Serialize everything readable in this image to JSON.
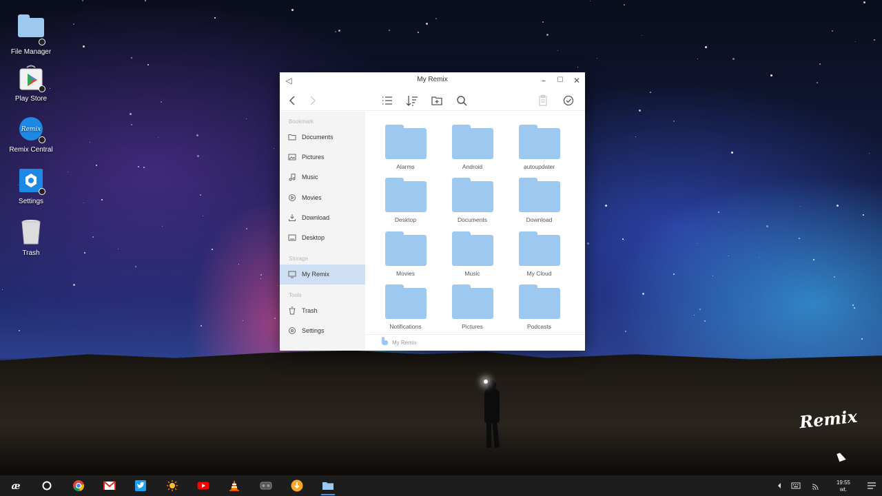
{
  "desktop": {
    "icons": [
      {
        "label": "File Manager",
        "icon": "folder-icon"
      },
      {
        "label": "Play Store",
        "icon": "play-store-icon"
      },
      {
        "label": "Remix Central",
        "icon": "remix-central-icon"
      },
      {
        "label": "Settings",
        "icon": "settings-icon"
      },
      {
        "label": "Trash",
        "icon": "trash-icon"
      }
    ],
    "watermark": "Remix"
  },
  "window": {
    "title": "My Remix",
    "sidebar": {
      "sections": {
        "bookmark": "Bookmark",
        "storage": "Storage",
        "tools": "Tools"
      },
      "bookmarks": [
        {
          "label": "Documents",
          "icon": "document-icon"
        },
        {
          "label": "Pictures",
          "icon": "picture-icon"
        },
        {
          "label": "Music",
          "icon": "music-icon"
        },
        {
          "label": "Movies",
          "icon": "movie-icon"
        },
        {
          "label": "Download",
          "icon": "download-icon"
        },
        {
          "label": "Desktop",
          "icon": "desktop-icon"
        }
      ],
      "storage": [
        {
          "label": "My Remix",
          "icon": "monitor-icon",
          "active": true
        }
      ],
      "tools": [
        {
          "label": "Trash",
          "icon": "trash-icon"
        },
        {
          "label": "Settings",
          "icon": "gear-icon"
        }
      ]
    },
    "folders": [
      "Alarms",
      "Android",
      "autoupdater",
      "Desktop",
      "Documents",
      "Download",
      "Movies",
      "Music",
      "My Cloud",
      "Notifications",
      "Pictures",
      "Podcasts"
    ],
    "status_path": "My Remix"
  },
  "taskbar": {
    "apps": [
      "remix-start-icon",
      "search-circle-icon",
      "chrome-icon",
      "gmail-icon",
      "twitter-icon",
      "weather-icon",
      "youtube-icon",
      "vlc-icon",
      "game-icon",
      "download-app-icon",
      "file-manager-icon"
    ],
    "clock": {
      "time": "19:55",
      "day": "wt."
    }
  },
  "colors": {
    "folder": "#9dc9f0",
    "active_sidebar": "#cfdff3",
    "taskbar": "#1d1d1d"
  }
}
